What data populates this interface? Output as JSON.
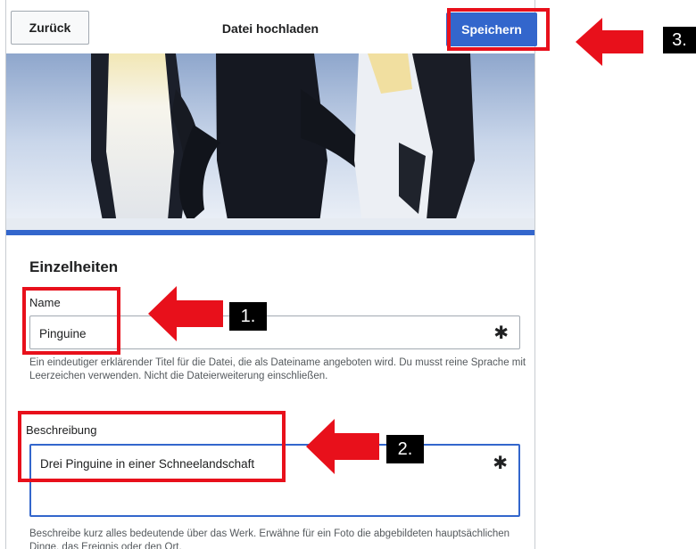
{
  "dialog": {
    "back_label": "Zurück",
    "title": "Datei hochladen",
    "save_label": "Speichern"
  },
  "details": {
    "heading": "Einzelheiten",
    "name": {
      "label": "Name",
      "value": "Pinguine",
      "required_mark": "✱",
      "help": "Ein eindeutiger erklärender Titel für die Datei, die als Dateiname angeboten wird. Du musst reine Sprache mit Leerzeichen verwenden. Nicht die Dateierweiterung einschließen."
    },
    "description": {
      "label": "Beschreibung",
      "value": "Drei Pinguine in einer Schneelandschaft",
      "required_mark": "✱",
      "help": "Beschreibe kurz alles bedeutende über das Werk. Erwähne für ein Foto die abgebildeten hauptsächlichen Dinge, das Ereignis oder den Ort."
    }
  },
  "annotations": {
    "step1": "1.",
    "step2": "2.",
    "step3": "3."
  },
  "colors": {
    "accent": "#3366cc",
    "highlight": "#e8101b",
    "badge": "#000000"
  },
  "icons": [
    "arrow-left-icon",
    "asterisk-icon"
  ]
}
